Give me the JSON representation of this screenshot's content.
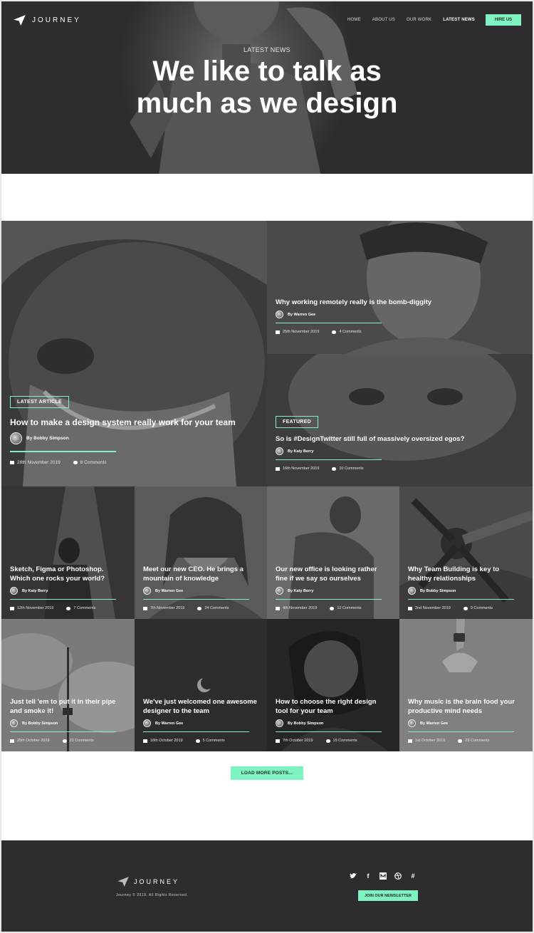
{
  "brand": {
    "name": "JOURNEY",
    "accent": "#7ef2c0",
    "dark": "#2d2d2f"
  },
  "nav": {
    "items": [
      "HOME",
      "ABOUT US",
      "OUR WORK",
      "LATEST NEWS"
    ],
    "active": "LATEST NEWS",
    "cta": "HIRE US"
  },
  "hero": {
    "eyebrow": "LATEST NEWS",
    "title_line1": "We like to talk as",
    "title_line2": "much as we design"
  },
  "posts": [
    {
      "tag": "LATEST ARTICLE",
      "title": "How to make a design system really work for your team",
      "author": "By Bobby Simpson",
      "date": "28th November 2019",
      "comments": "8 Comments"
    },
    {
      "tag": "",
      "title": "Why working remotely really is the bomb-diggity",
      "author": "By Warren Gee",
      "date": "25th November 2019",
      "comments": "4 Comments"
    },
    {
      "tag": "FEATURED",
      "title": "So is #DesignTwitter still full of massively oversized egos?",
      "author": "By Katy Berry",
      "date": "16th November 2019",
      "comments": "10 Comments"
    },
    {
      "tag": "",
      "title": "Sketch, Figma or Photoshop. Which one rocks your world?",
      "author": "By Katy Berry",
      "date": "12th November 2019",
      "comments": "7 Comments"
    },
    {
      "tag": "",
      "title": "Meet our new CEO. He brings a mountain of knowledge",
      "author": "By Warren Gee",
      "date": "7th November 2019",
      "comments": "24 Comments"
    },
    {
      "tag": "",
      "title": "Our new office is looking rather fine if we say so ourselves",
      "author": "By Katy Berry",
      "date": "4th November 2019",
      "comments": "12 Comments"
    },
    {
      "tag": "",
      "title": "Why Team Building is key to healthy relationships",
      "author": "By Bobby Simpson",
      "date": "2nd November 2019",
      "comments": "9 Comments"
    },
    {
      "tag": "",
      "title": "Just tell 'em to put it in their pipe and smoke it!",
      "author": "By Bobby Simpson",
      "date": "25th October 2019",
      "comments": "23 Comments"
    },
    {
      "tag": "",
      "title": "We've just welcomed one awesome designer to the team",
      "author": "By Warren Gee",
      "date": "18th October 2019",
      "comments": "5 Comments"
    },
    {
      "tag": "",
      "title": "How to choose the right design tool for your team",
      "author": "By Bobby Simpson",
      "date": "7th October 2019",
      "comments": "15 Comments"
    },
    {
      "tag": "",
      "title": "Why music is the brain food your productive mind needs",
      "author": "By Warren Gee",
      "date": "1st October 2019",
      "comments": "23 Comments"
    }
  ],
  "load_more": "LOAD MORE POSTS...",
  "footer": {
    "brand": "JOURNEY",
    "copyright": "Journey © 2019. All Rights Reserved.",
    "social_icons": [
      "twitter-icon",
      "facebook-icon",
      "medium-icon",
      "dribbble-icon",
      "slack-icon"
    ],
    "newsletter": "JOIN OUR NEWSLETTER"
  }
}
